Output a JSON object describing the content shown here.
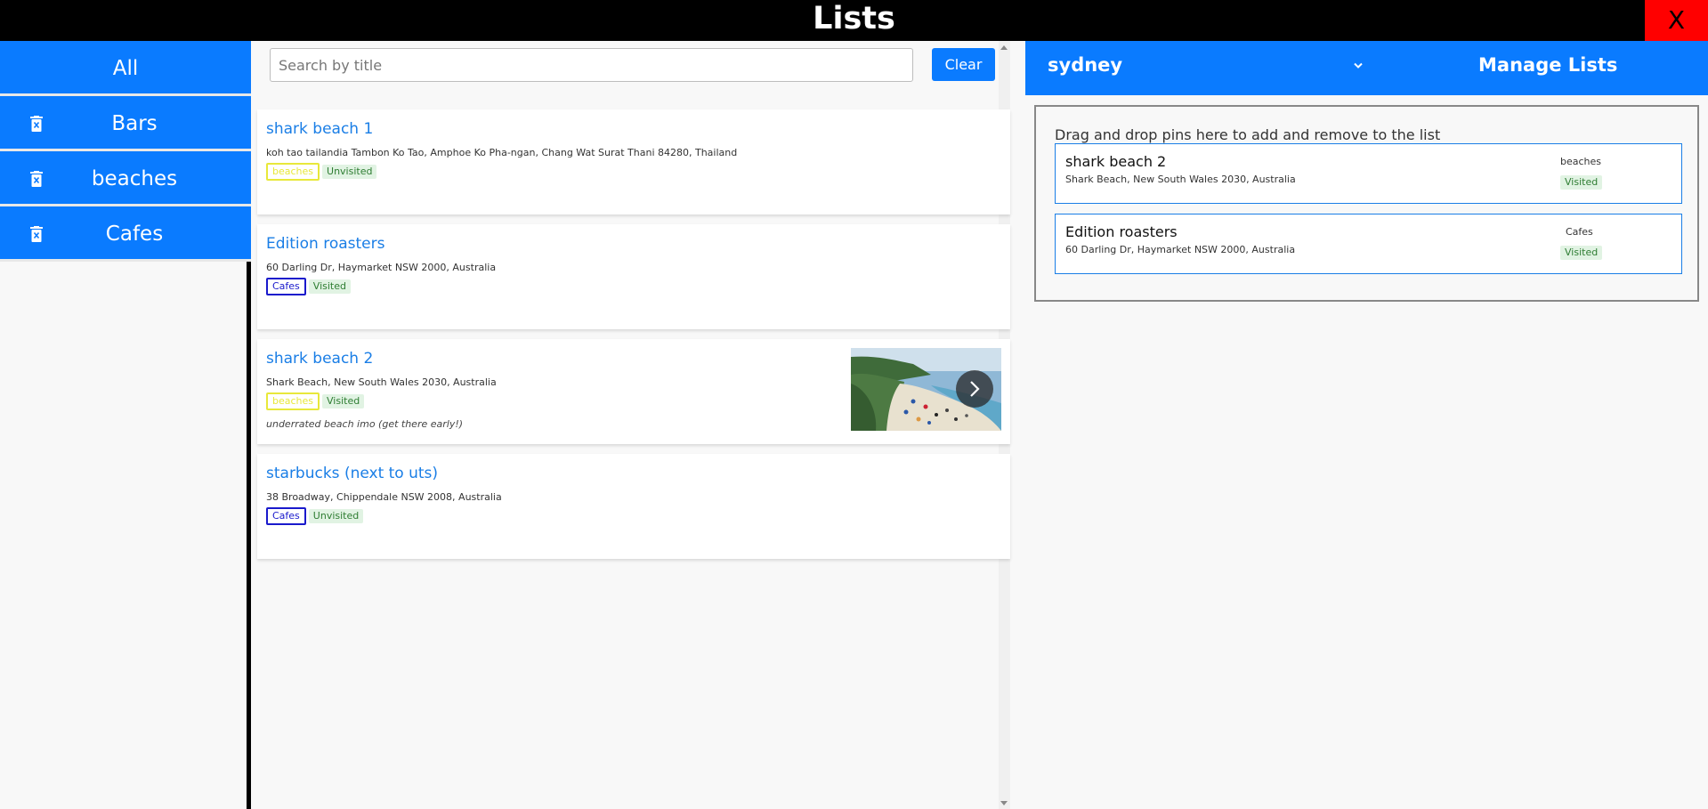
{
  "header": {
    "title": "Lists",
    "close_label": "X"
  },
  "sidebar": {
    "items": [
      {
        "label": "All"
      },
      {
        "label": "Bars"
      },
      {
        "label": "beaches"
      },
      {
        "label": "Cafes"
      }
    ]
  },
  "search": {
    "placeholder": "Search by title",
    "value": "",
    "clear_label": "Clear"
  },
  "cards": [
    {
      "title": "shark beach 1",
      "address": "koh tao tailandia Tambon Ko Tao, Amphoe Ko Pha-ngan, Chang Wat Surat Thani 84280, Thailand",
      "list": "beaches",
      "status": "Unvisited",
      "note": ""
    },
    {
      "title": "Edition roasters",
      "address": "60 Darling Dr, Haymarket NSW 2000, Australia",
      "list": "Cafes",
      "status": "Visited",
      "note": ""
    },
    {
      "title": "shark beach 2",
      "address": "Shark Beach, New South Wales 2030, Australia",
      "list": "beaches",
      "status": "Visited",
      "note": "underrated beach imo (get there early!)"
    },
    {
      "title": "starbucks (next to uts)",
      "address": "38 Broadway, Chippendale NSW 2008, Australia",
      "list": "Cafes",
      "status": "Unvisited",
      "note": ""
    }
  ],
  "right_panel": {
    "city": "sydney",
    "manage_label": "Manage Lists",
    "dropzone_label": "Drag and drop pins here to add and remove to the list",
    "pins": [
      {
        "title": "shark beach 2",
        "address": "Shark Beach, New South Wales 2030, Australia",
        "list": "beaches",
        "status": "Visited"
      },
      {
        "title": "Edition roasters",
        "address": "60 Darling Dr, Haymarket NSW 2000, Australia",
        "list": "Cafes",
        "status": "Visited"
      }
    ]
  },
  "colors": {
    "accent": "#0a7bff",
    "header_bg": "#000000",
    "close_bg": "#ff0000",
    "tag_beaches": "#e8e83a",
    "tag_cafes": "#1a1acc",
    "status_bg": "#e1f3e3",
    "status_text": "#2e7d32",
    "link_text": "#1a7ee6"
  },
  "icons": {
    "sidebar_delete": "trash-icon",
    "thumbnail_next": "chevron-right-icon",
    "city_dropdown": "chevron-down-icon"
  }
}
